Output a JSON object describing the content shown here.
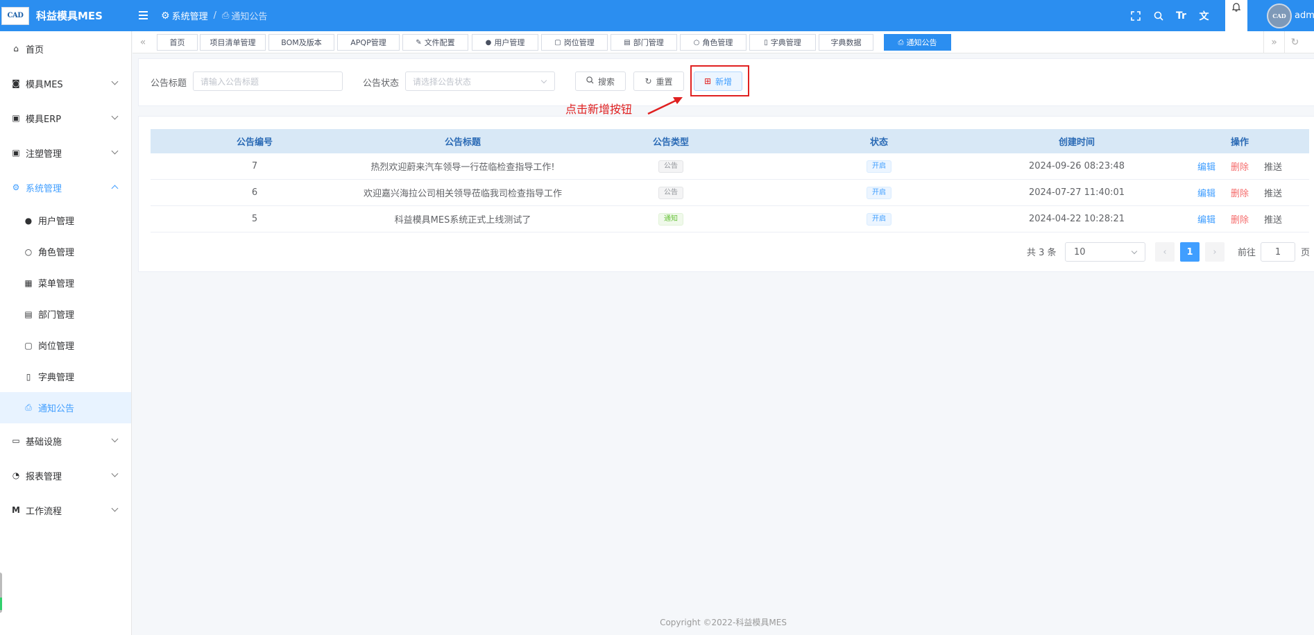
{
  "header": {
    "logo_badge": "CAD",
    "app_title": "科益模具MES",
    "breadcrumb": [
      "系统管理",
      "通知公告"
    ],
    "user_name": "adm",
    "tools": [
      "fullscreen-icon",
      "search-icon",
      "font-size-icon",
      "translate-icon",
      "bell-icon"
    ]
  },
  "sidebar": {
    "items": [
      {
        "label": "首页",
        "icon": "home-icon"
      },
      {
        "label": "模具MES",
        "icon": "camera-icon"
      },
      {
        "label": "模具ERP",
        "icon": "box-icon"
      },
      {
        "label": "注塑管理",
        "icon": "box-icon"
      },
      {
        "label": "系统管理",
        "icon": "gear-icon"
      }
    ],
    "sub_items": [
      {
        "label": "用户管理",
        "icon": "user-icon"
      },
      {
        "label": "角色管理",
        "icon": "user-outline-icon"
      },
      {
        "label": "菜单管理",
        "icon": "grid-icon"
      },
      {
        "label": "部门管理",
        "icon": "id-card-icon"
      },
      {
        "label": "岗位管理",
        "icon": "badge-icon"
      },
      {
        "label": "字典管理",
        "icon": "book-icon"
      },
      {
        "label": "通知公告",
        "icon": "inbox-icon"
      }
    ],
    "items_after": [
      {
        "label": "基础设施",
        "icon": "monitor-icon"
      },
      {
        "label": "报表管理",
        "icon": "pie-icon"
      },
      {
        "label": "工作流程",
        "icon": "flow-icon"
      }
    ]
  },
  "tags": [
    "首页",
    "项目清单管理",
    "BOM及版本",
    "APQP管理",
    "文件配置",
    "用户管理",
    "岗位管理",
    "部门管理",
    "角色管理",
    "字典管理",
    "字典数据",
    "通知公告"
  ],
  "search": {
    "title_label": "公告标题",
    "title_placeholder": "请输入公告标题",
    "status_label": "公告状态",
    "status_placeholder": "请选择公告状态",
    "search_btn": "搜索",
    "reset_btn": "重置",
    "add_btn": "新增"
  },
  "annotation": "点击新增按钮",
  "table": {
    "columns": [
      "公告编号",
      "公告标题",
      "公告类型",
      "状态",
      "创建时间",
      "操作"
    ],
    "rows": [
      {
        "id": "7",
        "title": "热烈欢迎蔚来汽车领导一行莅临检查指导工作!",
        "type": "公告",
        "type_style": "info",
        "status": "开启",
        "created": "2024-09-26 08:23:48"
      },
      {
        "id": "6",
        "title": "欢迎嘉兴海拉公司相关领导莅临我司检查指导工作",
        "type": "公告",
        "type_style": "info",
        "status": "开启",
        "created": "2024-07-27 11:40:01"
      },
      {
        "id": "5",
        "title": "科益模具MES系统正式上线测试了",
        "type": "通知",
        "type_style": "success",
        "status": "开启",
        "created": "2024-04-22 10:28:21"
      }
    ],
    "actions": [
      "编辑",
      "删除",
      "推送"
    ]
  },
  "pagination": {
    "total_text": "共 3 条",
    "page_size": "10",
    "current_page": "1",
    "goto_label": "前往",
    "goto_value": "1",
    "page_unit": "页"
  },
  "footer": "Copyright ©2022-科益模具MES",
  "colors": {
    "header": "#2b8ef0",
    "primary": "#409eff",
    "danger": "#f56c6c",
    "annotation": "#e02020"
  }
}
